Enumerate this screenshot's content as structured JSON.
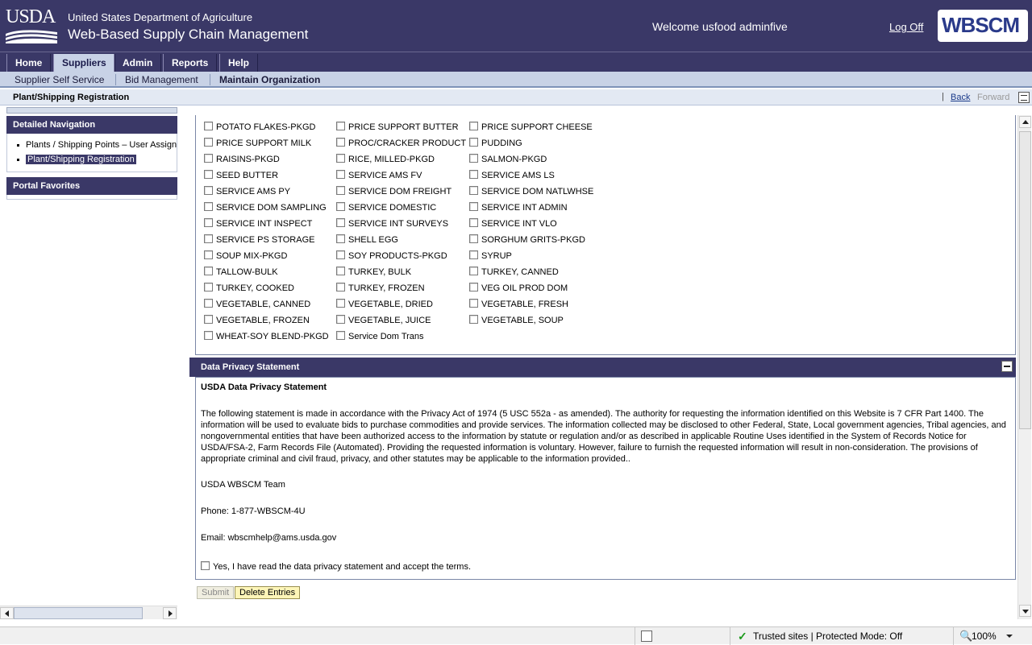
{
  "header": {
    "logo_text": "USDA",
    "department": "United States Department of Agriculture",
    "system_name": "Web-Based Supply Chain Management",
    "welcome": "Welcome usfood adminfive",
    "logoff": "Log Off",
    "brand_logo": "WBSCM"
  },
  "topnav": {
    "tabs": [
      "Home",
      "Suppliers",
      "Admin",
      "Reports",
      "Help"
    ],
    "active": "Suppliers"
  },
  "subnav": {
    "items": [
      "Supplier Self Service",
      "Bid Management",
      "Maintain Organization"
    ]
  },
  "titlebar": {
    "title": "Plant/Shipping Registration",
    "back": "Back",
    "forward": "Forward"
  },
  "leftnav": {
    "detailed_heading": "Detailed Navigation",
    "items": [
      "Plants / Shipping Points – User Assignment",
      "Plant/Shipping Registration"
    ],
    "favorites_heading": "Portal Favorites"
  },
  "commodities": {
    "rows": [
      [
        "POTATO FLAKES-PKGD",
        "PRICE SUPPORT BUTTER",
        "PRICE SUPPORT CHEESE"
      ],
      [
        "PRICE SUPPORT MILK",
        "PROC/CRACKER PRODUCT",
        "PUDDING"
      ],
      [
        "RAISINS-PKGD",
        "RICE, MILLED-PKGD",
        "SALMON-PKGD"
      ],
      [
        "SEED BUTTER",
        "SERVICE AMS FV",
        "SERVICE AMS LS"
      ],
      [
        "SERVICE AMS PY",
        "SERVICE DOM FREIGHT",
        "SERVICE DOM NATLWHSE"
      ],
      [
        "SERVICE DOM SAMPLING",
        "SERVICE DOMESTIC",
        "SERVICE INT ADMIN"
      ],
      [
        "SERVICE INT INSPECT",
        "SERVICE INT SURVEYS",
        "SERVICE INT VLO"
      ],
      [
        "SERVICE PS STORAGE",
        "SHELL EGG",
        "SORGHUM GRITS-PKGD"
      ],
      [
        "SOUP MIX-PKGD",
        "SOY PRODUCTS-PKGD",
        "SYRUP"
      ],
      [
        "TALLOW-BULK",
        "TURKEY, BULK",
        "TURKEY, CANNED"
      ],
      [
        "TURKEY, COOKED",
        "TURKEY, FROZEN",
        "VEG OIL PROD DOM"
      ],
      [
        "VEGETABLE, CANNED",
        "VEGETABLE, DRIED",
        "VEGETABLE, FRESH"
      ],
      [
        "VEGETABLE, FROZEN",
        "VEGETABLE, JUICE",
        "VEGETABLE, SOUP"
      ],
      [
        "WHEAT-SOY BLEND-PKGD",
        "Service Dom Trans",
        ""
      ]
    ]
  },
  "privacy": {
    "section_heading": "Data Privacy Statement",
    "title": "USDA Data Privacy Statement",
    "paragraph": "The following statement is made in accordance with the Privacy Act of 1974 (5 USC 552a - as amended). The authority for requesting the information identified on this Website is 7 CFR Part 1400. The information will be used to evaluate bids to purchase commodities and provide services. The information collected may be disclosed to other Federal, State, Local government agencies, Tribal agencies, and nongovernmental entities that have been authorized access to the information by statute or regulation and/or as described in applicable Routine Uses identified in the System of Records Notice for USDA/FSA-2, Farm Records File (Automated). Providing the requested information is voluntary. However, failure to furnish the requested information will result in non-consideration. The provisions of appropriate criminal and civil fraud, privacy, and other statutes may be applicable to the information provided..",
    "team": "USDA WBSCM Team",
    "phone": "Phone: 1-877-WBSCM-4U",
    "email": "Email: wbscmhelp@ams.usda.gov",
    "accept_label": "Yes, I have read the data privacy statement and accept the terms."
  },
  "buttons": {
    "submit": "Submit",
    "delete": "Delete Entries"
  },
  "statusbar": {
    "zone": "Trusted sites | Protected Mode: Off",
    "zoom": "100%"
  },
  "colors": {
    "header_bg": "#3a3867",
    "subnav_bg": "#c8d2e6",
    "delete_button_bg": "#fdf5b8"
  }
}
